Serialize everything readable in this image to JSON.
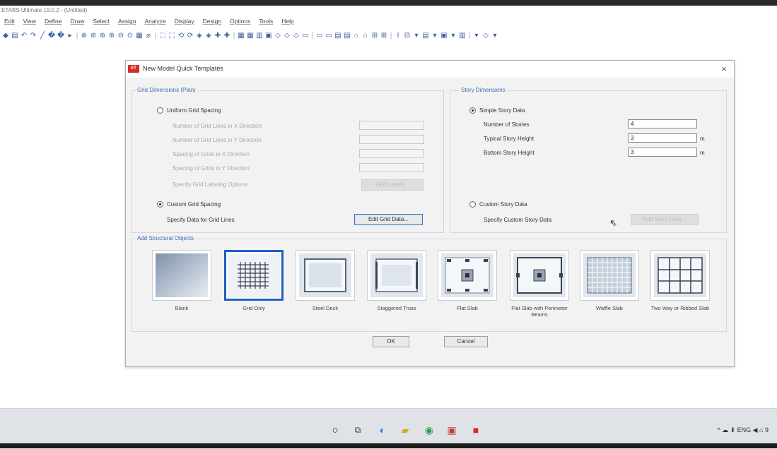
{
  "app": {
    "title": "ETABS Ultimate 19.0.2 - (Untitled)",
    "menu": [
      "Edit",
      "View",
      "Define",
      "Draw",
      "Select",
      "Assign",
      "Analyze",
      "Display",
      "Design",
      "Options",
      "Tools",
      "Help"
    ]
  },
  "dialog": {
    "title": "New Model Quick Templates",
    "close_glyph": "×",
    "grid": {
      "title": "Grid Dimensions (Plan)",
      "uniform_label": "Uniform Grid Spacing",
      "rows": [
        {
          "label": "Number of Grid Lines in X Direction",
          "value": ""
        },
        {
          "label": "Number of Grid Lines in Y Direction",
          "value": ""
        },
        {
          "label": "Spacing of Grids in X Direction",
          "value": ""
        },
        {
          "label": "Spacing of Grids in Y Direction",
          "value": ""
        }
      ],
      "labeling_label": "Specify Grid Labeling Options",
      "labeling_button": "Grid Labels...",
      "custom_label": "Custom Grid Spacing",
      "specify_label": "Specify Data for Grid Lines",
      "edit_button": "Edit Grid Data..."
    },
    "story": {
      "title": "Story Dimensions",
      "simple_label": "Simple Story Data",
      "rows": [
        {
          "label": "Number of Stories",
          "value": "4",
          "unit": ""
        },
        {
          "label": "Typical Story Height",
          "value": "3",
          "unit": "m"
        },
        {
          "label": "Bottom Story Height",
          "value": "3",
          "unit": "m"
        }
      ],
      "custom_label": "Custom Story Data",
      "specify_label": "Specify Custom Story Data",
      "edit_button": "Edit Story Data..."
    },
    "objects": {
      "title": "Add Structural Objects",
      "tiles": [
        {
          "label": "Blank"
        },
        {
          "label": "Grid Only"
        },
        {
          "label": "Steel Deck"
        },
        {
          "label": "Staggered Truss"
        },
        {
          "label": "Flat Slab"
        },
        {
          "label": "Flat Slab with Perimeter Beams"
        },
        {
          "label": "Waffle Slab"
        },
        {
          "label": "Two Way or Ribbed Slab"
        }
      ]
    },
    "ok": "OK",
    "cancel": "Cancel"
  },
  "taskbar": {
    "tray_text": "^ ☁ ⬇ ENG ◀ ⌂ 9"
  },
  "colors": {
    "accent": "#1f5fc4",
    "group_title": "#3d6db1",
    "etabs_logo": "#d42a2a"
  }
}
